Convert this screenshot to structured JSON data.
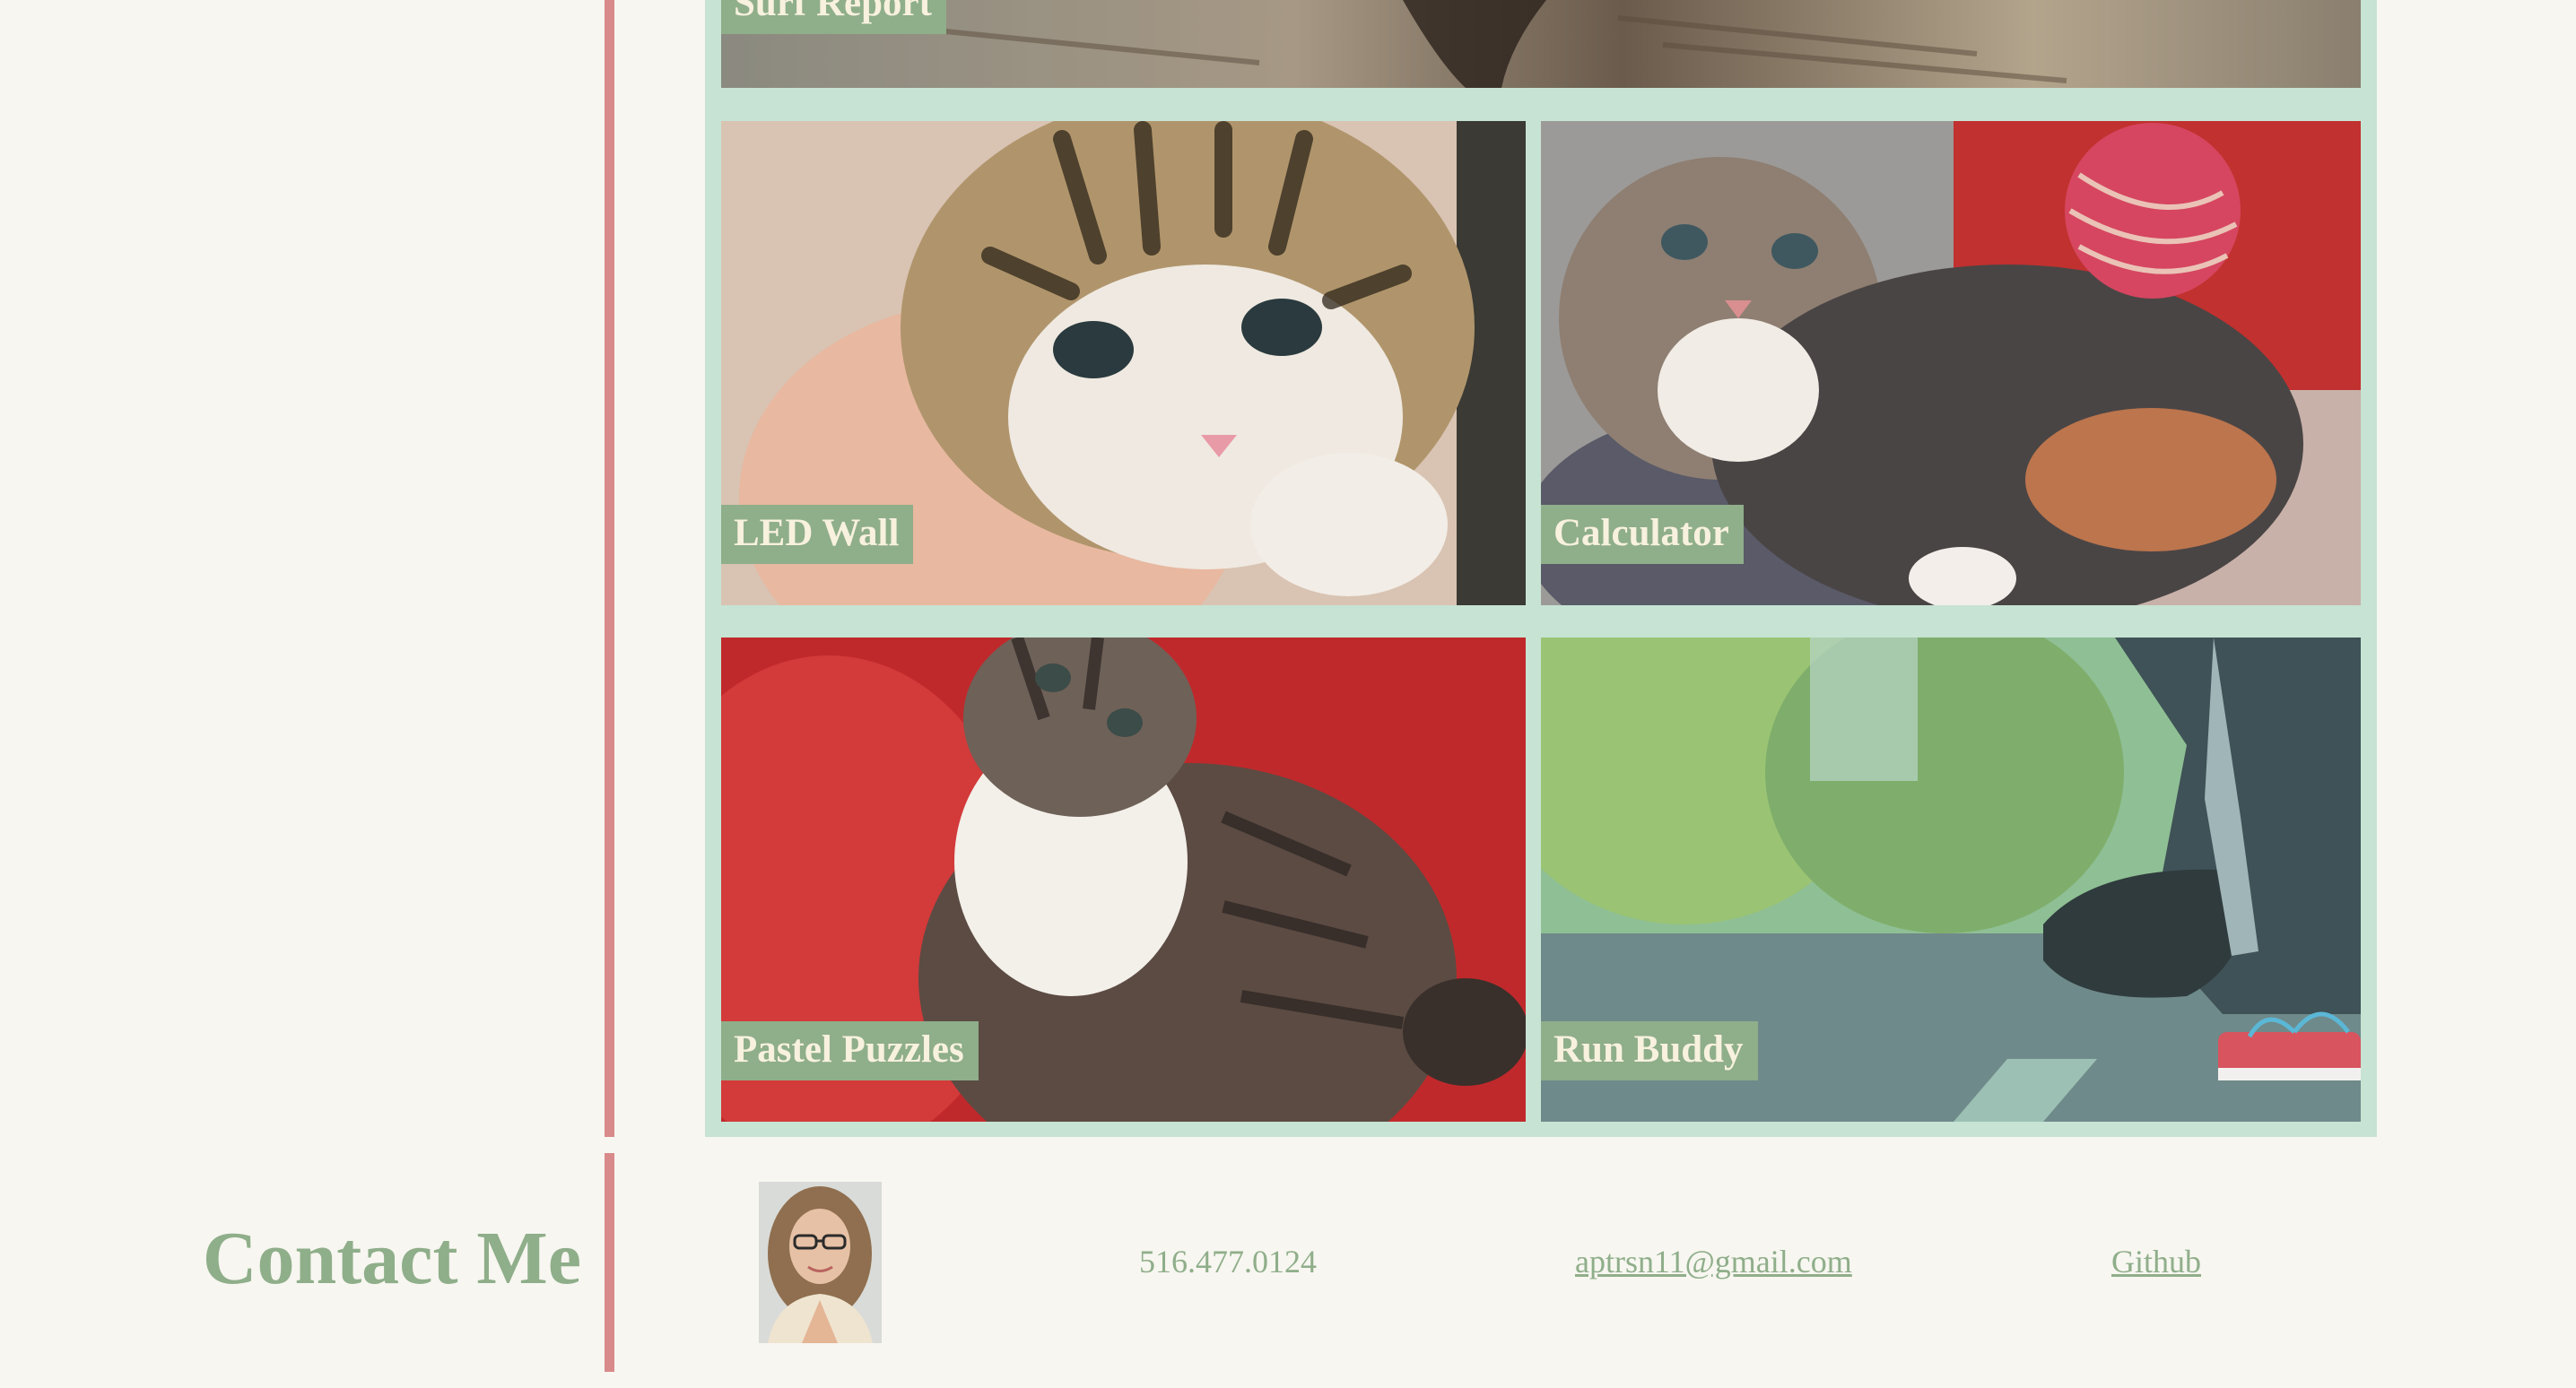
{
  "projects": {
    "top_card_label": "Surf Report",
    "cards": [
      {
        "label": "LED Wall"
      },
      {
        "label": "Calculator"
      },
      {
        "label": "Pastel Puzzles"
      },
      {
        "label": "Run Buddy"
      }
    ]
  },
  "contact": {
    "title": "Contact Me",
    "phone": "516.477.0124",
    "email": "aptrsn11@gmail.com",
    "github": "Github"
  },
  "colors": {
    "accent_green": "#8fae8a",
    "gallery_bg": "#c6e3d3",
    "divider_pink": "#d98a8a",
    "page_bg": "#f7f6f0",
    "label_text": "#f7f1de"
  }
}
